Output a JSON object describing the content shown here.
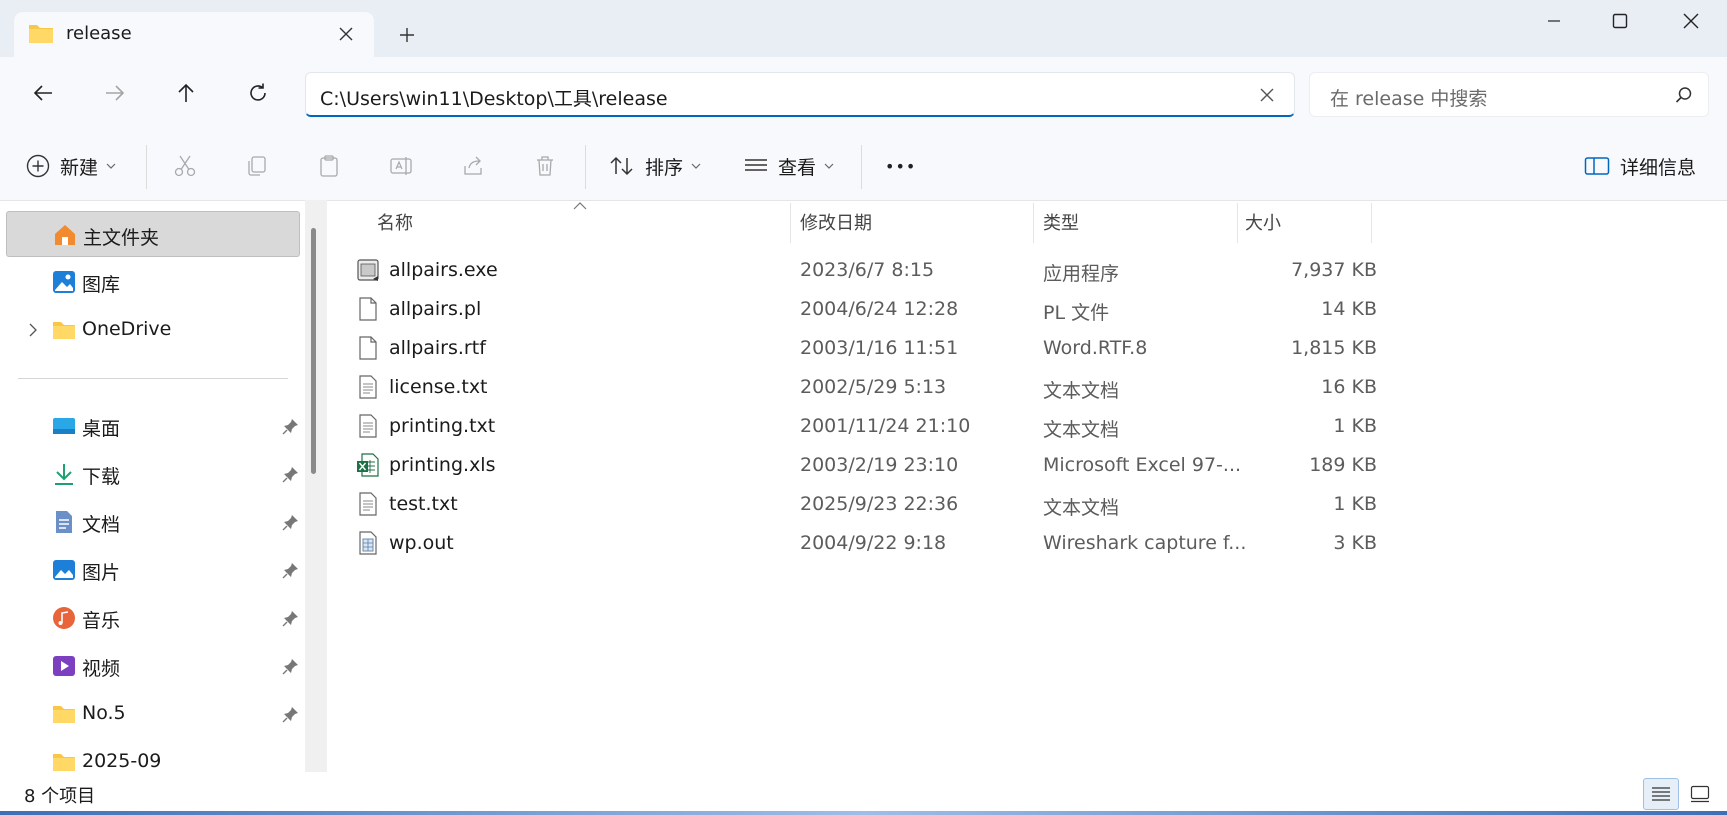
{
  "tab": {
    "title": "release"
  },
  "window_controls": [
    "minimize",
    "maximize",
    "close"
  ],
  "address": {
    "path": "C:\\Users\\win11\\Desktop\\工具\\release"
  },
  "search": {
    "placeholder": "在 release 中搜索"
  },
  "toolbar": {
    "new_label": "新建",
    "sort_label": "排序",
    "view_label": "查看",
    "more_label": "•••",
    "details_label": "详细信息"
  },
  "sidebar": {
    "top_items": [
      {
        "label": "主文件夹",
        "icon": "home-icon"
      },
      {
        "label": "图库",
        "icon": "gallery-icon"
      },
      {
        "label": "OneDrive",
        "icon": "folder-icon"
      }
    ],
    "pinned_items": [
      {
        "label": "桌面",
        "icon": "desktop-icon"
      },
      {
        "label": "下载",
        "icon": "download-icon"
      },
      {
        "label": "文档",
        "icon": "document-icon"
      },
      {
        "label": "图片",
        "icon": "pictures-icon"
      },
      {
        "label": "音乐",
        "icon": "music-icon"
      },
      {
        "label": "视频",
        "icon": "video-icon"
      },
      {
        "label": "No.5",
        "icon": "folder-icon"
      },
      {
        "label": "2025-09",
        "icon": "folder-icon"
      }
    ]
  },
  "columns": {
    "name": "名称",
    "date": "修改日期",
    "type": "类型",
    "size": "大小"
  },
  "files": [
    {
      "name": "allpairs.exe",
      "date": "2023/6/7 8:15",
      "type": "应用程序",
      "size": "7,937 KB",
      "icon": "exe-icon"
    },
    {
      "name": "allpairs.pl",
      "date": "2004/6/24 12:28",
      "type": "PL 文件",
      "size": "14 KB",
      "icon": "file-icon"
    },
    {
      "name": "allpairs.rtf",
      "date": "2003/1/16 11:51",
      "type": "Word.RTF.8",
      "size": "1,815 KB",
      "icon": "file-icon"
    },
    {
      "name": "license.txt",
      "date": "2002/5/29 5:13",
      "type": "文本文档",
      "size": "16 KB",
      "icon": "text-file-icon"
    },
    {
      "name": "printing.txt",
      "date": "2001/11/24 21:10",
      "type": "文本文档",
      "size": "1 KB",
      "icon": "text-file-icon"
    },
    {
      "name": "printing.xls",
      "date": "2003/2/19 23:10",
      "type": "Microsoft Excel 97-...",
      "size": "189 KB",
      "icon": "excel-file-icon"
    },
    {
      "name": "test.txt",
      "date": "2025/9/23 22:36",
      "type": "文本文档",
      "size": "1 KB",
      "icon": "text-file-icon"
    },
    {
      "name": "wp.out",
      "date": "2004/9/22 9:18",
      "type": "Wireshark capture f...",
      "size": "3 KB",
      "icon": "capture-file-icon"
    }
  ],
  "status": {
    "item_count": "8 个项目"
  },
  "colors": {
    "accent": "#0067c0",
    "folder": "#f8c74a",
    "chrome": "#e9eef5",
    "toolbar": "#f7f9fc"
  }
}
